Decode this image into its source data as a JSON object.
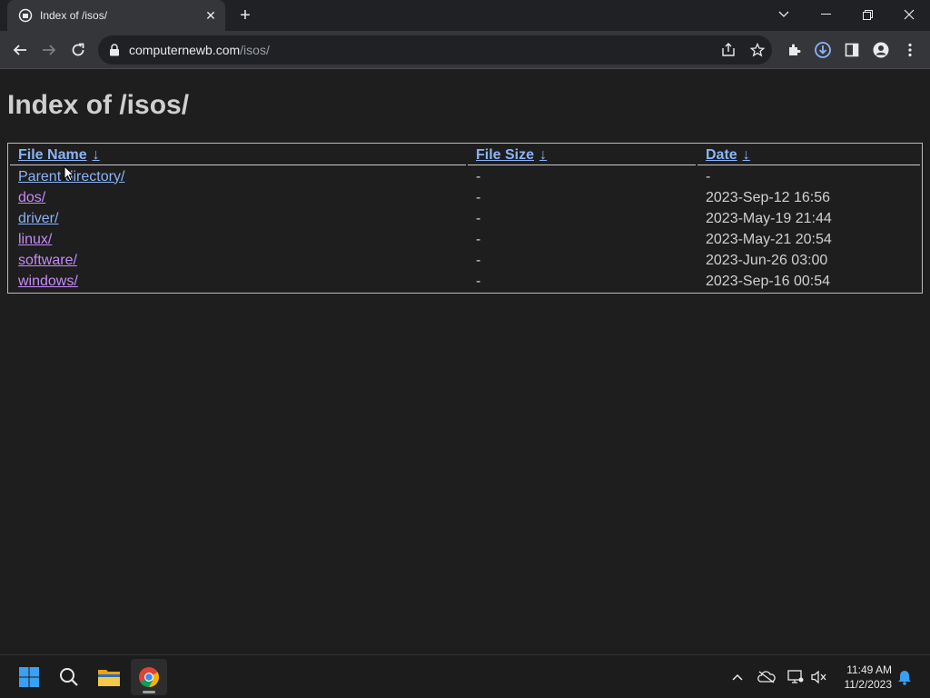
{
  "browser": {
    "tab_title": "Index of /isos/",
    "url_domain": "computernewb.com",
    "url_path": "/isos/"
  },
  "page": {
    "heading": "Index of /isos/",
    "columns": {
      "name": "File Name",
      "size": "File Size",
      "date": "Date",
      "sort_arrow": "↓"
    },
    "rows": [
      {
        "name": "Parent directory/",
        "size": "-",
        "date": "-"
      },
      {
        "name": "dos/",
        "size": "-",
        "date": "2023-Sep-12 16:56"
      },
      {
        "name": "driver/",
        "size": "-",
        "date": "2023-May-19 21:44"
      },
      {
        "name": "linux/",
        "size": "-",
        "date": "2023-May-21 20:54"
      },
      {
        "name": "software/",
        "size": "-",
        "date": "2023-Jun-26 03:00"
      },
      {
        "name": "windows/",
        "size": "-",
        "date": "2023-Sep-16 00:54"
      }
    ]
  },
  "taskbar": {
    "time": "11:49 AM",
    "date": "11/2/2023"
  },
  "colors": {
    "link": "#8ab4f8",
    "visited_link": "#c58af9",
    "page_bg": "#1e1e1e"
  }
}
